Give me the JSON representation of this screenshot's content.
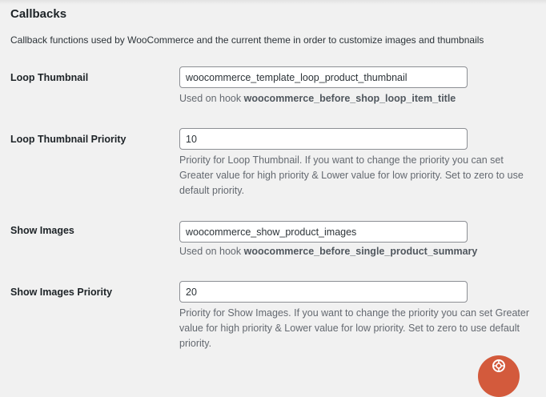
{
  "section": {
    "title": "Callbacks",
    "description": "Callback functions used by WooCommerce and the current theme in order to customize images and thumbnails"
  },
  "fields": {
    "loop_thumbnail": {
      "label": "Loop Thumbnail",
      "value": "woocommerce_template_loop_product_thumbnail",
      "help_prefix": "Used on hook ",
      "help_hook": "woocommerce_before_shop_loop_item_title"
    },
    "loop_thumbnail_priority": {
      "label": "Loop Thumbnail Priority",
      "value": "10",
      "help": "Priority for Loop Thumbnail. If you want to change the priority you can set Greater value for high priority & Lower value for low priority. Set to zero to use default priority."
    },
    "show_images": {
      "label": "Show Images",
      "value": "woocommerce_show_product_images",
      "help_prefix": "Used on hook ",
      "help_hook": "woocommerce_before_single_product_summary"
    },
    "show_images_priority": {
      "label": "Show Images Priority",
      "value": "20",
      "help": "Priority for Show Images. If you want to change the priority you can set Greater value for high priority & Lower value for low priority. Set to zero to use default priority."
    }
  },
  "help_button": {
    "icon": "lifebuoy-icon",
    "color": "#d35a3c"
  }
}
